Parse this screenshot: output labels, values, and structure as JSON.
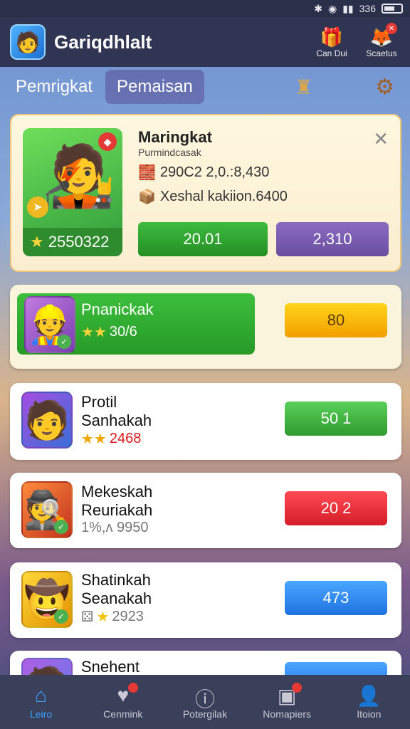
{
  "status_bar": {
    "time": "336"
  },
  "header": {
    "app_name": "Gariqdhlalt",
    "buttons": [
      {
        "label": "Can Dui",
        "icon": "treasure-chest-icon"
      },
      {
        "label": "Scaetus",
        "icon": "profile-badge-icon"
      }
    ]
  },
  "tabs": [
    {
      "label": "Pemrigkat",
      "active": false
    },
    {
      "label": "Pemaisan",
      "active": true
    }
  ],
  "featured": {
    "title": "Maringkat",
    "subtitle": "Purmindcasak",
    "line1": "290C2 2,0.:8,430",
    "line2": "Xeshal kakiion.6400",
    "score": "2550322",
    "buttons": [
      "20.01",
      "2,310"
    ]
  },
  "list": [
    {
      "name1": "Pnanickak",
      "name2": "",
      "meta": "30/6",
      "action": "80",
      "color": "#ffb300",
      "selected": true
    },
    {
      "name1": "Protil",
      "name2": "Sanhakah",
      "meta": "2468",
      "action": "50 1",
      "color": "#3eb83e",
      "selected": false
    },
    {
      "name1": "Mekeskah",
      "name2": "Reuriakah",
      "meta": "1%,ʌ 9950",
      "action": "20 2",
      "color": "#e8323a",
      "selected": false
    },
    {
      "name1": "Shatinkah",
      "name2": "Seanakah",
      "meta": "2923",
      "action": "473",
      "color": "#2f86f0",
      "selected": false
    },
    {
      "name1": "Snehent",
      "name2": "",
      "meta": "",
      "action": "",
      "color": "#2f86f0",
      "selected": false
    }
  ],
  "bottom_nav": [
    {
      "label": "Leiro",
      "icon": "home-icon",
      "active": true
    },
    {
      "label": "Cenmink",
      "icon": "chat-icon",
      "active": false
    },
    {
      "label": "Potergilak",
      "icon": "info-icon",
      "active": false
    },
    {
      "label": "Nomapiers",
      "icon": "camera-icon",
      "active": false
    },
    {
      "label": "Itoion",
      "icon": "user-icon",
      "active": false
    }
  ]
}
